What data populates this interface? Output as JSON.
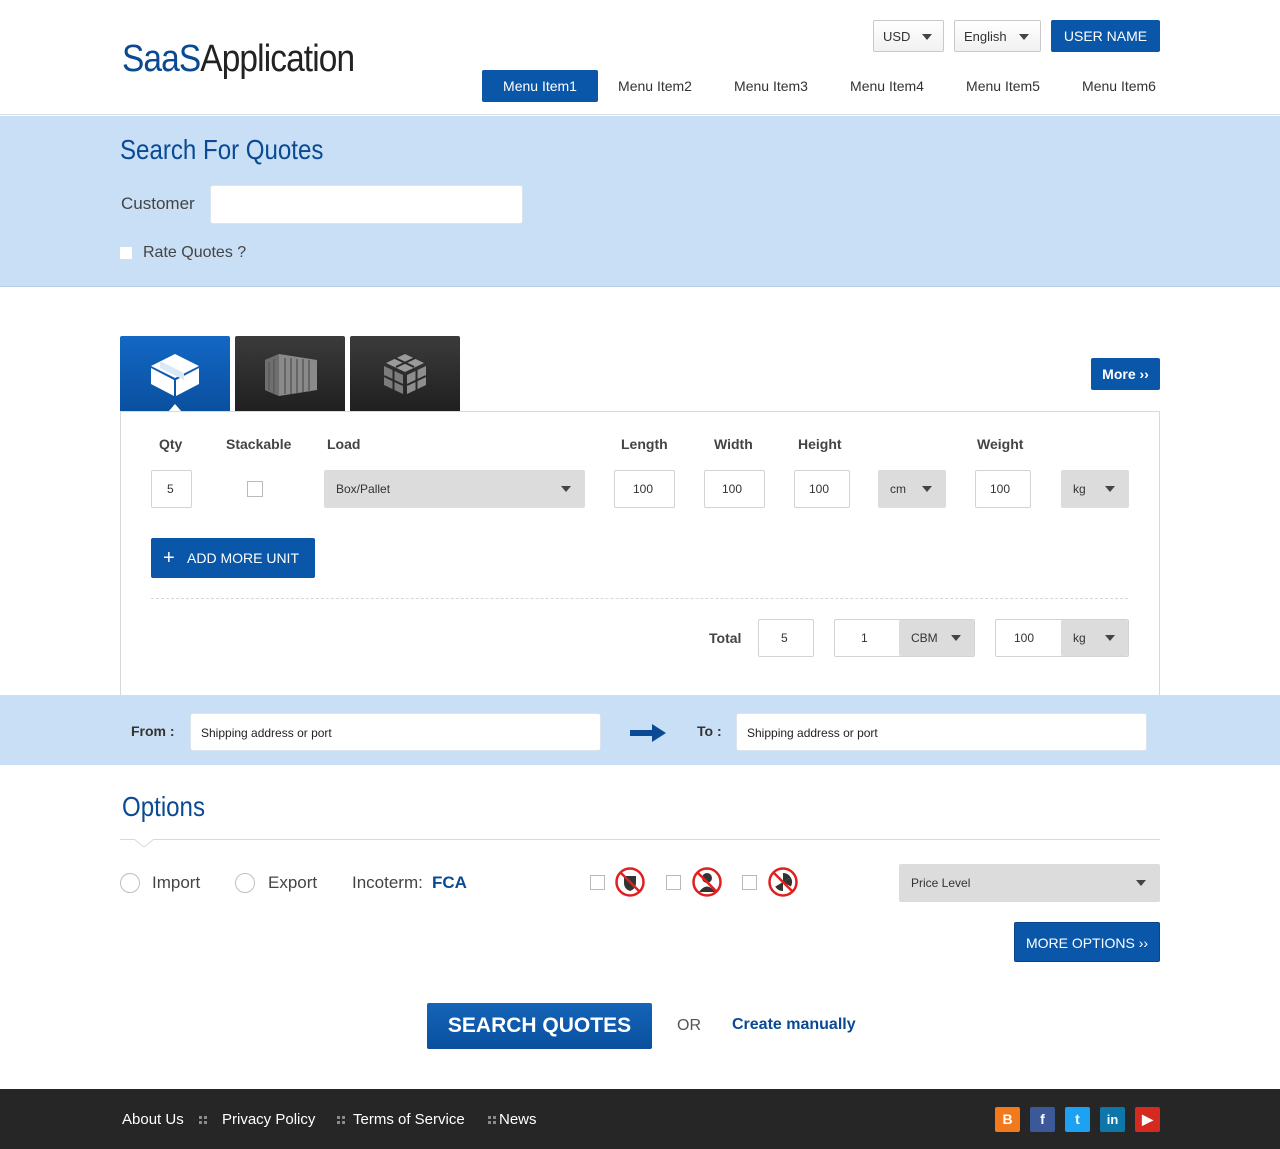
{
  "header": {
    "logo_part1": "SaaS",
    "logo_part2": "Application",
    "currency": "USD",
    "language": "English",
    "user_name": "USER NAME",
    "menu": [
      "Menu Item1",
      "Menu Item2",
      "Menu Item3",
      "Menu Item4",
      "Menu Item5",
      "Menu Item6"
    ],
    "active_menu": "Menu Item1"
  },
  "search": {
    "title": "Search For Quotes",
    "customer_label": "Customer",
    "customer_value": "",
    "rate_quotes_label": "Rate Quotes ?"
  },
  "cargo": {
    "tabs": [
      "box-icon",
      "container-icon",
      "pallet-icon"
    ],
    "more_label": "More",
    "columns": {
      "qty": "Qty",
      "stackable": "Stackable",
      "load": "Load",
      "length": "Length",
      "width": "Width",
      "height": "Height",
      "weight": "Weight"
    },
    "row": {
      "qty": "5",
      "load": "Box/Pallet",
      "length": "100",
      "width": "100",
      "height": "100",
      "dim_unit": "cm",
      "weight": "100",
      "weight_unit": "kg"
    },
    "add_more_label": "ADD MORE UNIT",
    "total": {
      "label": "Total",
      "qty": "5",
      "volume": "1",
      "volume_unit": "CBM",
      "weight": "100",
      "weight_unit": "kg"
    }
  },
  "route": {
    "from_label": "From :",
    "from_value": "Shipping address or port",
    "to_label": "To :",
    "to_value": "Shipping address or port"
  },
  "options": {
    "title": "Options",
    "import_label": "Import",
    "export_label": "Export",
    "incoterm_label": "Incoterm:",
    "incoterm_value": "FCA",
    "hazard_icons": [
      "no-weapons-icon",
      "no-person-icon",
      "no-radioactive-icon"
    ],
    "price_level": "Price Level",
    "more_options_label": "MORE OPTIONS"
  },
  "actions": {
    "search_label": "SEARCH QUOTES",
    "or_label": "OR",
    "create_label": "Create manually"
  },
  "footer": {
    "links": [
      "About Us",
      "Privacy Policy",
      "Terms of Service",
      "News"
    ],
    "social": [
      "blogger-icon",
      "facebook-icon",
      "twitter-icon",
      "linkedin-icon",
      "youtube-icon"
    ]
  },
  "colors": {
    "brand_blue": "#0a56a8",
    "band_blue": "#c8dff5",
    "footer_dark": "#262626"
  }
}
